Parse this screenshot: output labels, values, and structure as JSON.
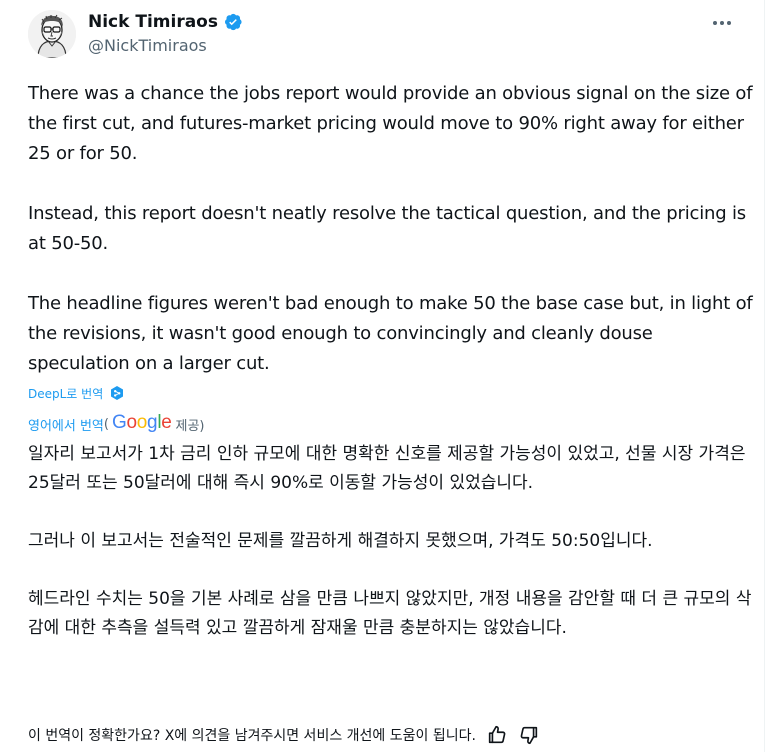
{
  "author": {
    "name": "Nick Timiraos",
    "handle": "@NickTimiraos",
    "verified": true,
    "verified_color": "#1d9bf0"
  },
  "tweet": {
    "paragraphs": [
      "There was a chance the jobs report would provide an obvious signal on the size of the first cut, and futures-market pricing would move to 90% right away for either 25 or for 50.",
      "Instead, this report doesn't neatly resolve the tactical question, and the pricing is at 50-50.",
      "The headline figures weren't bad enough to make 50 the base case but, in light of the revisions, it wasn't good enough to convincingly and cleanly douse speculation on a larger cut."
    ]
  },
  "translation": {
    "deepl_label": "DeepL로 번역",
    "google_prefix": "영어에서 번역",
    "google_open_paren": "(",
    "google_logo": [
      "G",
      "o",
      "o",
      "g",
      "l",
      "e"
    ],
    "google_suffix": "제공)",
    "paragraphs": [
      "일자리 보고서가 1차 금리 인하 규모에 대한 명확한 신호를 제공할 가능성이 있었고, 선물 시장 가격은 25달러 또는 50달러에 대해 즉시 90%로 이동할 가능성이 있었습니다.",
      "그러나 이 보고서는 전술적인 문제를 깔끔하게 해결하지 못했으며, 가격도 50:50입니다.",
      "헤드라인 수치는 50을 기본 사례로 삼을 만큼 나쁘지 않았지만, 개정 내용을 감안할 때 더 큰 규모의 삭감에 대한 추측을 설득력 있고 깔끔하게 잠재울 만큼 충분하지는 않았습니다."
    ],
    "feedback_prompt": "이 번역이 정확한가요? X에 의견을 남겨주시면 서비스 개선에 도움이 됩니다."
  },
  "icons": {
    "more": "more-horizontal-icon",
    "verified": "verified-badge-icon",
    "deepl": "deepl-icon",
    "thumbs_up": "thumbs-up-icon",
    "thumbs_down": "thumbs-down-icon"
  }
}
